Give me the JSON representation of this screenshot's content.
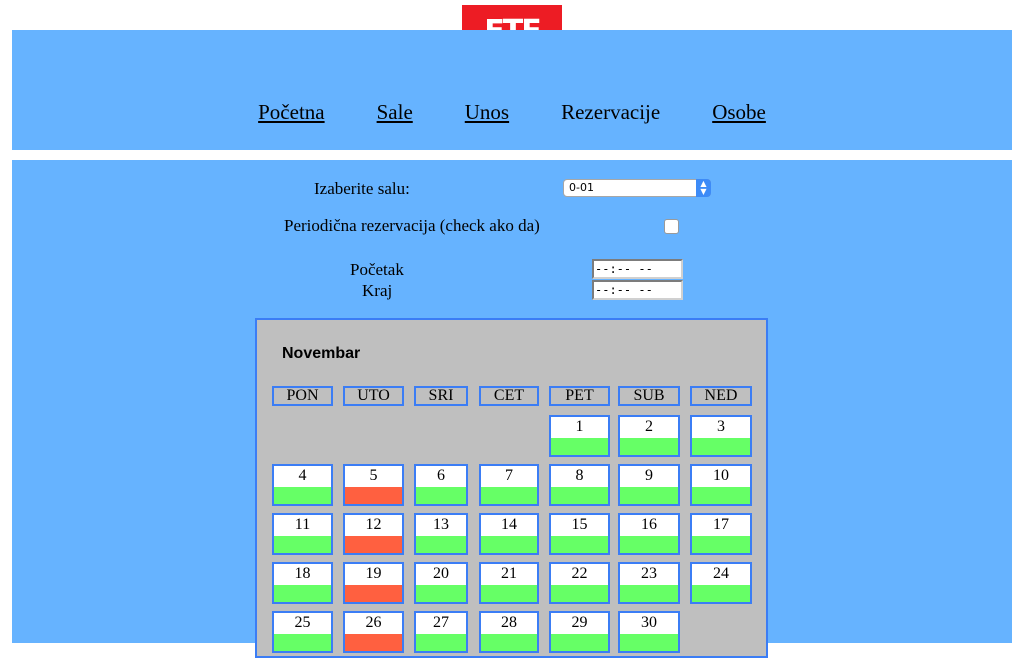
{
  "logo": {
    "text": "ETF"
  },
  "nav": [
    {
      "label": "Početna",
      "current": false
    },
    {
      "label": "Sale",
      "current": false
    },
    {
      "label": "Unos",
      "current": false
    },
    {
      "label": "Rezervacije",
      "current": true
    },
    {
      "label": "Osobe",
      "current": false
    }
  ],
  "form": {
    "room_label": "Izaberite salu:",
    "room_value": "0-01",
    "periodic_label": "Periodična rezervacija (check ako da)",
    "periodic_checked": false,
    "start_label": "Početak",
    "end_label": "Kraj",
    "start_value": "--:-- --",
    "end_value": "--:-- --"
  },
  "calendar": {
    "month": "Novembar",
    "day_names": [
      "PON",
      "UTO",
      "SRI",
      "CET",
      "PET",
      "SUB",
      "NED"
    ],
    "first_weekday_index": 4,
    "days": [
      {
        "n": "1",
        "status": "free"
      },
      {
        "n": "2",
        "status": "free"
      },
      {
        "n": "3",
        "status": "free"
      },
      {
        "n": "4",
        "status": "free"
      },
      {
        "n": "5",
        "status": "busy"
      },
      {
        "n": "6",
        "status": "free"
      },
      {
        "n": "7",
        "status": "free"
      },
      {
        "n": "8",
        "status": "free"
      },
      {
        "n": "9",
        "status": "free"
      },
      {
        "n": "10",
        "status": "free"
      },
      {
        "n": "11",
        "status": "free"
      },
      {
        "n": "12",
        "status": "busy"
      },
      {
        "n": "13",
        "status": "free"
      },
      {
        "n": "14",
        "status": "free"
      },
      {
        "n": "15",
        "status": "free"
      },
      {
        "n": "16",
        "status": "free"
      },
      {
        "n": "17",
        "status": "free"
      },
      {
        "n": "18",
        "status": "free"
      },
      {
        "n": "19",
        "status": "busy"
      },
      {
        "n": "20",
        "status": "free"
      },
      {
        "n": "21",
        "status": "free"
      },
      {
        "n": "22",
        "status": "free"
      },
      {
        "n": "23",
        "status": "free"
      },
      {
        "n": "24",
        "status": "free"
      },
      {
        "n": "25",
        "status": "free"
      },
      {
        "n": "26",
        "status": "busy"
      },
      {
        "n": "27",
        "status": "free"
      },
      {
        "n": "28",
        "status": "free"
      },
      {
        "n": "29",
        "status": "free"
      },
      {
        "n": "30",
        "status": "free"
      }
    ]
  },
  "colors": {
    "header_bg": "#66b3ff",
    "logo_red": "#ed1c24",
    "calendar_bg": "#bfbfbf",
    "cell_border": "#3b7df5",
    "free": "#66ff66",
    "busy": "#ff6040"
  }
}
